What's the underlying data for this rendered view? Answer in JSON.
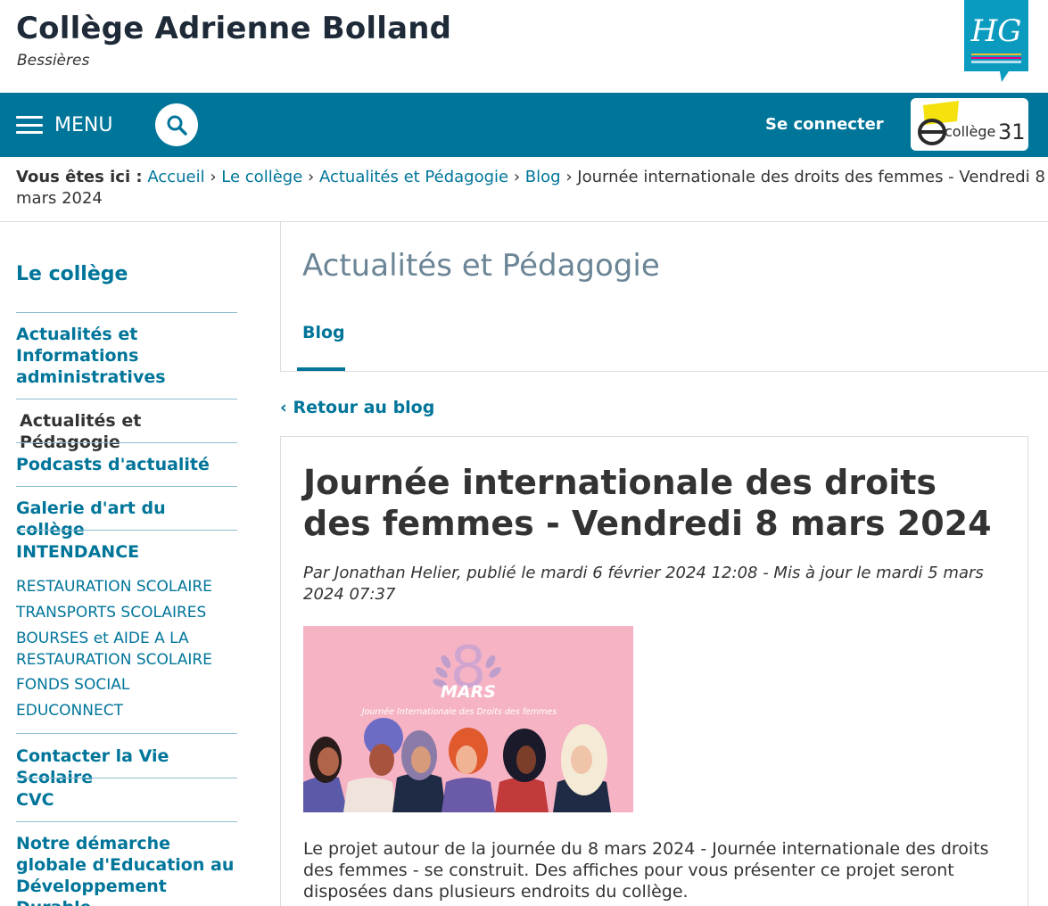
{
  "header": {
    "title": "Collège Adrienne Bolland",
    "subtitle": "Bessières"
  },
  "nav": {
    "menu_label": "MENU",
    "connect_label": "Se connecter"
  },
  "breadcrumb": {
    "prefix": "Vous êtes ici :",
    "links": [
      "Accueil",
      "Le collège",
      "Actualités et Pédagogie",
      "Blog"
    ],
    "separator": "›",
    "current": "Journée internationale des droits des femmes - Vendredi 8 mars 2024"
  },
  "sidebar": {
    "heading": "Le collège",
    "item_admin": "Actualités et Informations administratives",
    "item_current": "Actualités et Pédagogie",
    "item_podcasts": "Podcasts d'actualité",
    "item_galerie": "Galerie d'art du collège",
    "item_intendance": "INTENDANCE",
    "sub_items": [
      "RESTAURATION SCOLAIRE",
      "TRANSPORTS SCOLAIRES",
      "BOURSES et AIDE A LA RESTAURATION SCOLAIRE",
      "FONDS SOCIAL",
      "EDUCONNECT"
    ],
    "item_vie_scolaire": "Contacter la Vie Scolaire",
    "item_cvc": "CVC",
    "item_demarche": "Notre démarche globale d'Education au Développement Durable"
  },
  "main": {
    "section_title": "Actualités et Pédagogie",
    "tab_label": "Blog",
    "back_label": "‹ Retour au blog"
  },
  "article": {
    "title": "Journée internationale des droits des femmes - Vendredi 8 mars 2024",
    "meta": "Par Jonathan Helier, publié le mardi 6 février 2024 12:08 - Mis à jour le mardi 5 mars 2024 07:37",
    "image_big_number": "8",
    "image_mars": "MARS",
    "image_caption": "Journée Internationale des Droits des femmes",
    "body": "Le projet autour de la journée du 8 mars 2024 - Journée internationale des droits des femmes - se construit. Des affiches pour vous présenter ce projet seront disposées dans plusieurs endroits du collège."
  },
  "logos": {
    "hg_text": "HG",
    "ecollege_text": "collège",
    "ecollege_number": "31"
  },
  "colors": {
    "accent": "#00759a",
    "image_bg": "#f5b3c4"
  }
}
